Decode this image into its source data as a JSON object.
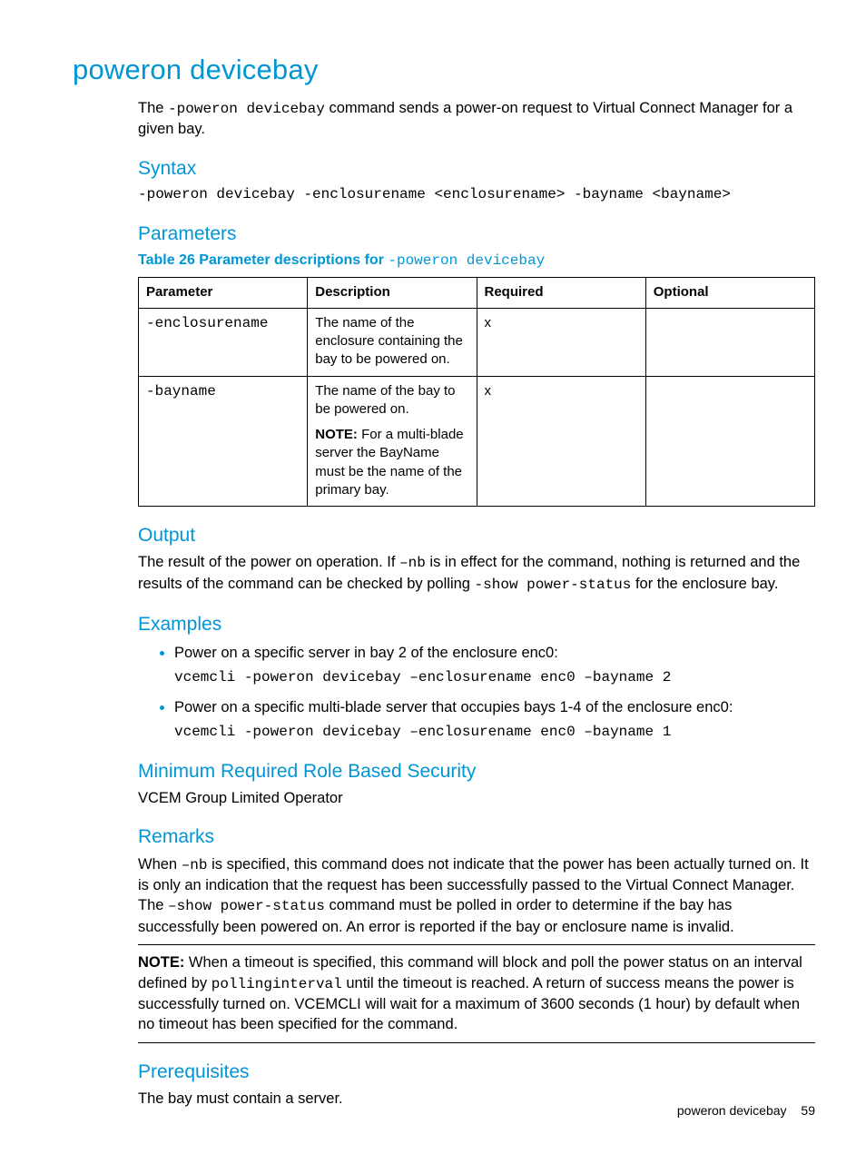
{
  "title": "poweron devicebay",
  "intro_before": "The ",
  "intro_cmd": "-poweron devicebay",
  "intro_after": " command sends a power-on request to Virtual Connect Manager for a given bay.",
  "syntax": {
    "heading": "Syntax",
    "line": "-poweron devicebay -enclosurename  <enclosurename> -bayname <bayname>"
  },
  "parameters": {
    "heading": "Parameters",
    "caption_strong": "Table 26 Parameter descriptions for ",
    "caption_cmd": "-poweron devicebay",
    "headers": {
      "param": "Parameter",
      "desc": "Description",
      "req": "Required",
      "opt": "Optional"
    },
    "rows": [
      {
        "param": "-enclosurename",
        "desc": "The name of the enclosure containing the bay to be powered on.",
        "req": "x",
        "opt": ""
      },
      {
        "param": "-bayname",
        "desc": "The name of the bay to be powered on.",
        "note_label": "NOTE:",
        "note": "   For a multi-blade server the BayName must be the name of the primary bay.",
        "req": "x",
        "opt": ""
      }
    ]
  },
  "output": {
    "heading": "Output",
    "t1": "The result of the power on operation. If ",
    "m1": "–nb",
    "t2": " is in effect for the command, nothing is returned and the results of the command can be checked by polling ",
    "m2": "-show power-status",
    "t3": " for the enclosure bay."
  },
  "examples": {
    "heading": "Examples",
    "items": [
      {
        "text": "Power on a specific server in bay 2 of the enclosure enc0:",
        "cmd": "vcemcli -poweron devicebay –enclosurename enc0 –bayname 2"
      },
      {
        "text": "Power on a specific multi-blade server that occupies bays 1-4 of the enclosure enc0:",
        "cmd": "vcemcli -poweron devicebay –enclosurename enc0 –bayname 1"
      }
    ]
  },
  "rbs": {
    "heading": "Minimum Required Role Based Security",
    "text": "VCEM Group Limited Operator"
  },
  "remarks": {
    "heading": "Remarks",
    "t1": "When ",
    "m1": "–nb",
    "t2": " is specified, this command does not indicate that the power has been actually turned on. It is only an indication that the request has been successfully passed to the Virtual Connect Manager. The ",
    "m2": "–show power-status",
    "t3": " command must be polled in order to determine if the bay has successfully been powered on. An error is reported if the bay or enclosure name is invalid.",
    "note_label": "NOTE:",
    "note_t1": "   When a timeout is specified, this command will block and poll the power status on an interval defined by ",
    "note_m1": "pollinginterval",
    "note_t2": " until the timeout is reached. A return of success means the power is successfully turned on. VCEMCLI will wait for a maximum of 3600 seconds (1 hour) by default when no timeout has been specified for the command."
  },
  "prereq": {
    "heading": "Prerequisites",
    "text": "The bay must contain a server."
  },
  "footer": {
    "title": "poweron devicebay",
    "page": "59"
  }
}
